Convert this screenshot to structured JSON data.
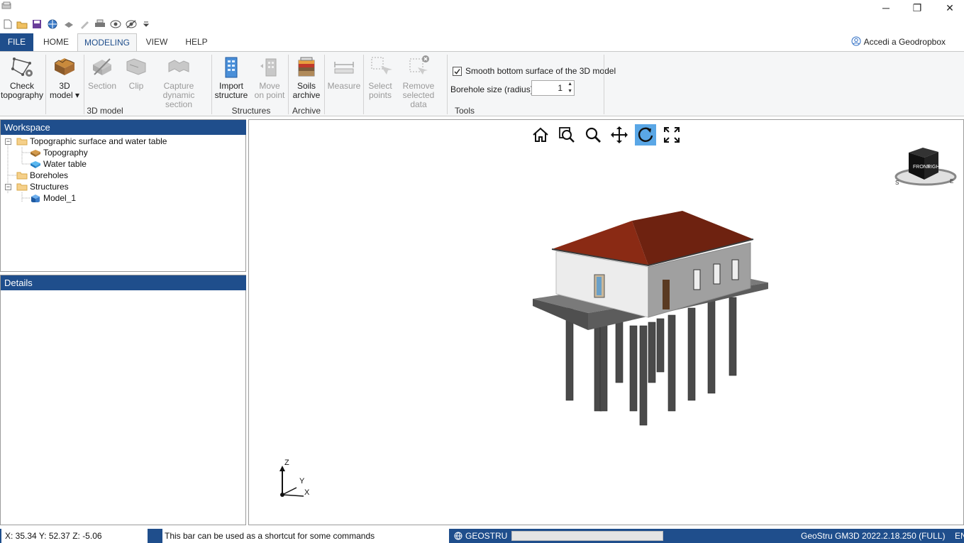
{
  "window": {
    "controls": [
      "─",
      "❐",
      "✕"
    ]
  },
  "quick_access": {
    "icons": [
      "new-file-icon",
      "open-folder-icon",
      "save-icon",
      "web-icon",
      "layers-icon",
      "pen-icon",
      "print-icon",
      "eye-icon",
      "eye-hidden-icon",
      "dropdown-arrow-icon"
    ]
  },
  "tabs": {
    "file": "FILE",
    "home": "HOME",
    "modeling": "MODELING",
    "view": "VIEW",
    "help": "HELP",
    "active": "MODELING"
  },
  "account": {
    "label": "Accedi a Geodropbox"
  },
  "ribbon": {
    "model3d": {
      "group_label": "3D model",
      "check_topography": [
        "Check",
        "topography"
      ],
      "model_3d": [
        "3D",
        "model"
      ],
      "section": [
        "Section"
      ],
      "clip": [
        "Clip"
      ],
      "capture": [
        "Capture",
        "dynamic section"
      ]
    },
    "structures": {
      "group_label": "Structures",
      "import": [
        "Import",
        "structure"
      ],
      "move": [
        "Move",
        "on point"
      ]
    },
    "archive": {
      "group_label": "Archive",
      "soils": [
        "Soils",
        "archive"
      ]
    },
    "tools": {
      "group_label": "Tools",
      "measure": [
        "Measure"
      ],
      "select": [
        "Select",
        "points"
      ],
      "remove": [
        "Remove",
        "selected data"
      ],
      "smooth_label": "Smooth bottom surface of the 3D model",
      "smooth_checked": true,
      "borehole_label": "Borehole size (radius) m",
      "borehole_value": "1"
    }
  },
  "workspace": {
    "title": "Workspace",
    "tree": [
      {
        "label": "Topographic surface and water table",
        "icon": "folder-icon",
        "level": 0
      },
      {
        "label": "Topography",
        "icon": "topography-icon",
        "level": 1
      },
      {
        "label": "Water table",
        "icon": "water-table-icon",
        "level": 1
      },
      {
        "label": "Boreholes",
        "icon": "folder-icon",
        "level": 0
      },
      {
        "label": "Structures",
        "icon": "folder-icon",
        "level": 0
      },
      {
        "label": "Model_1",
        "icon": "model-cube-icon",
        "level": 1
      }
    ]
  },
  "details": {
    "title": "Details"
  },
  "viewport": {
    "tools": [
      "home-icon",
      "zoom-window-icon",
      "zoom-icon",
      "pan-icon",
      "rotate-icon",
      "fullscreen-icon"
    ],
    "active_tool": "rotate-icon",
    "nav_cube": {
      "front": "FRONT",
      "right": "RIGHT",
      "south": "S",
      "east": "E"
    },
    "axes": {
      "z": "Z",
      "y": "Y",
      "x": "X"
    },
    "colors": {
      "roof": "#7a2410",
      "wall_light": "#ececec",
      "wall_shade": "#9c9c9c",
      "slab": "#6b6b6b",
      "pile": "#4a4a4a",
      "active_tool": "#5aa7e6"
    }
  },
  "status": {
    "coords": "X: 35.34   Y: 52.37   Z: -5.06",
    "hint": "This bar can be used as a shortcut for some commands",
    "brand": "GEOSTRU",
    "version": "GeoStru GM3D 2022.2.18.250 (FULL)",
    "lang": "EN",
    "colors": {
      "bar": "#1f4e8c",
      "cell": "#ffffff"
    }
  }
}
